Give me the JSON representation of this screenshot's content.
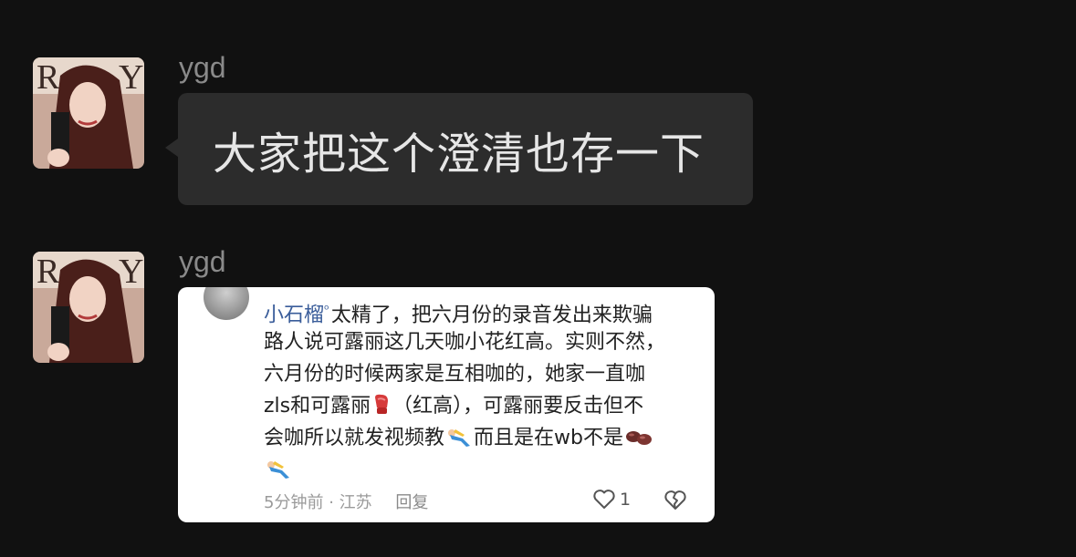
{
  "messages": [
    {
      "sender": "ygd",
      "avatar_icon": "profile-photo-icon",
      "text": "大家把这个澄清也存一下"
    },
    {
      "sender": "ygd",
      "avatar_icon": "profile-photo-icon",
      "card": {
        "username": "小石榴",
        "lines": [
          "太精了，把六月份的录音发出来欺骗",
          "路人说可露丽这几天咖小花红高。实则不然，",
          "六月份的时候两家是互相咖的，她家一直咖",
          "zls和可露丽",
          "（红高），可露丽要反击但不",
          "会咖所以就发视频教",
          "而且是在wb不是"
        ],
        "time": "5分钟前",
        "separator": "·",
        "location": "江苏",
        "reply_label": "回复",
        "like_count": "1",
        "icons": [
          "verified-badge-icon",
          "boxing-glove-emoji-icon",
          "diver-emoji-icon",
          "beans-emoji-icon",
          "heart-icon",
          "broken-heart-icon"
        ]
      }
    }
  ],
  "colors": {
    "background": "#111111",
    "bubble": "#2c2c2c",
    "card": "#ffffff",
    "username": "#3a5d9a",
    "sender": "#8a8a8a"
  }
}
